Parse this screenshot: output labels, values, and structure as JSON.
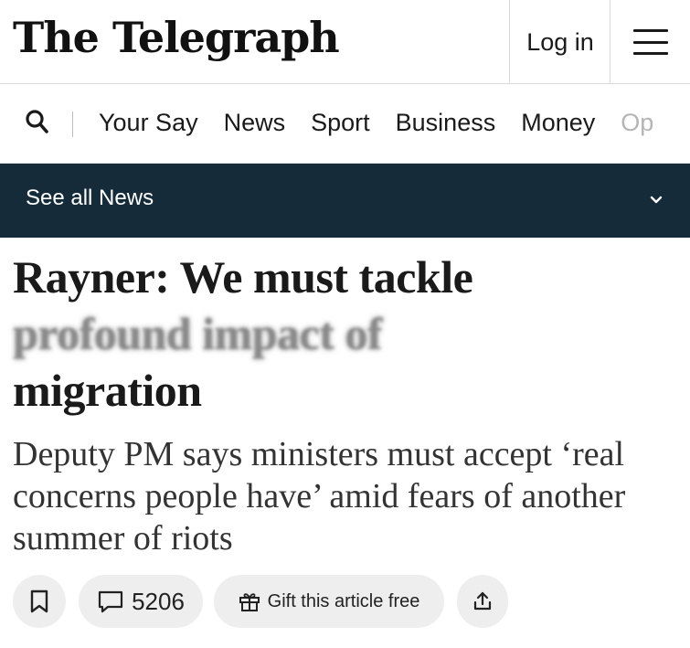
{
  "masthead": {
    "logo": "The Telegraph",
    "login_label": "Log in"
  },
  "nav": {
    "items": [
      "Your Say",
      "News",
      "Sport",
      "Business",
      "Money",
      "Op"
    ]
  },
  "section": {
    "label": "See all News"
  },
  "article": {
    "headline_line1": "Rayner: We must tackle",
    "headline_line2": "profound impact of",
    "headline_line3": "migration",
    "standfirst": "Deputy PM says ministers must accept ‘real concerns people have’ amid fears of another summer of riots"
  },
  "actions": {
    "comment_count": "5206",
    "gift_label": "Gift this article free"
  },
  "icons": {
    "search": "search-icon",
    "menu": "hamburger-menu-icon",
    "chevron": "chevron-down-icon",
    "bookmark": "bookmark-icon",
    "comment": "comment-icon",
    "gift": "gift-icon",
    "share": "share-icon"
  },
  "colors": {
    "section_bar": "#152b3a",
    "pill_bg": "#eeeeee"
  }
}
